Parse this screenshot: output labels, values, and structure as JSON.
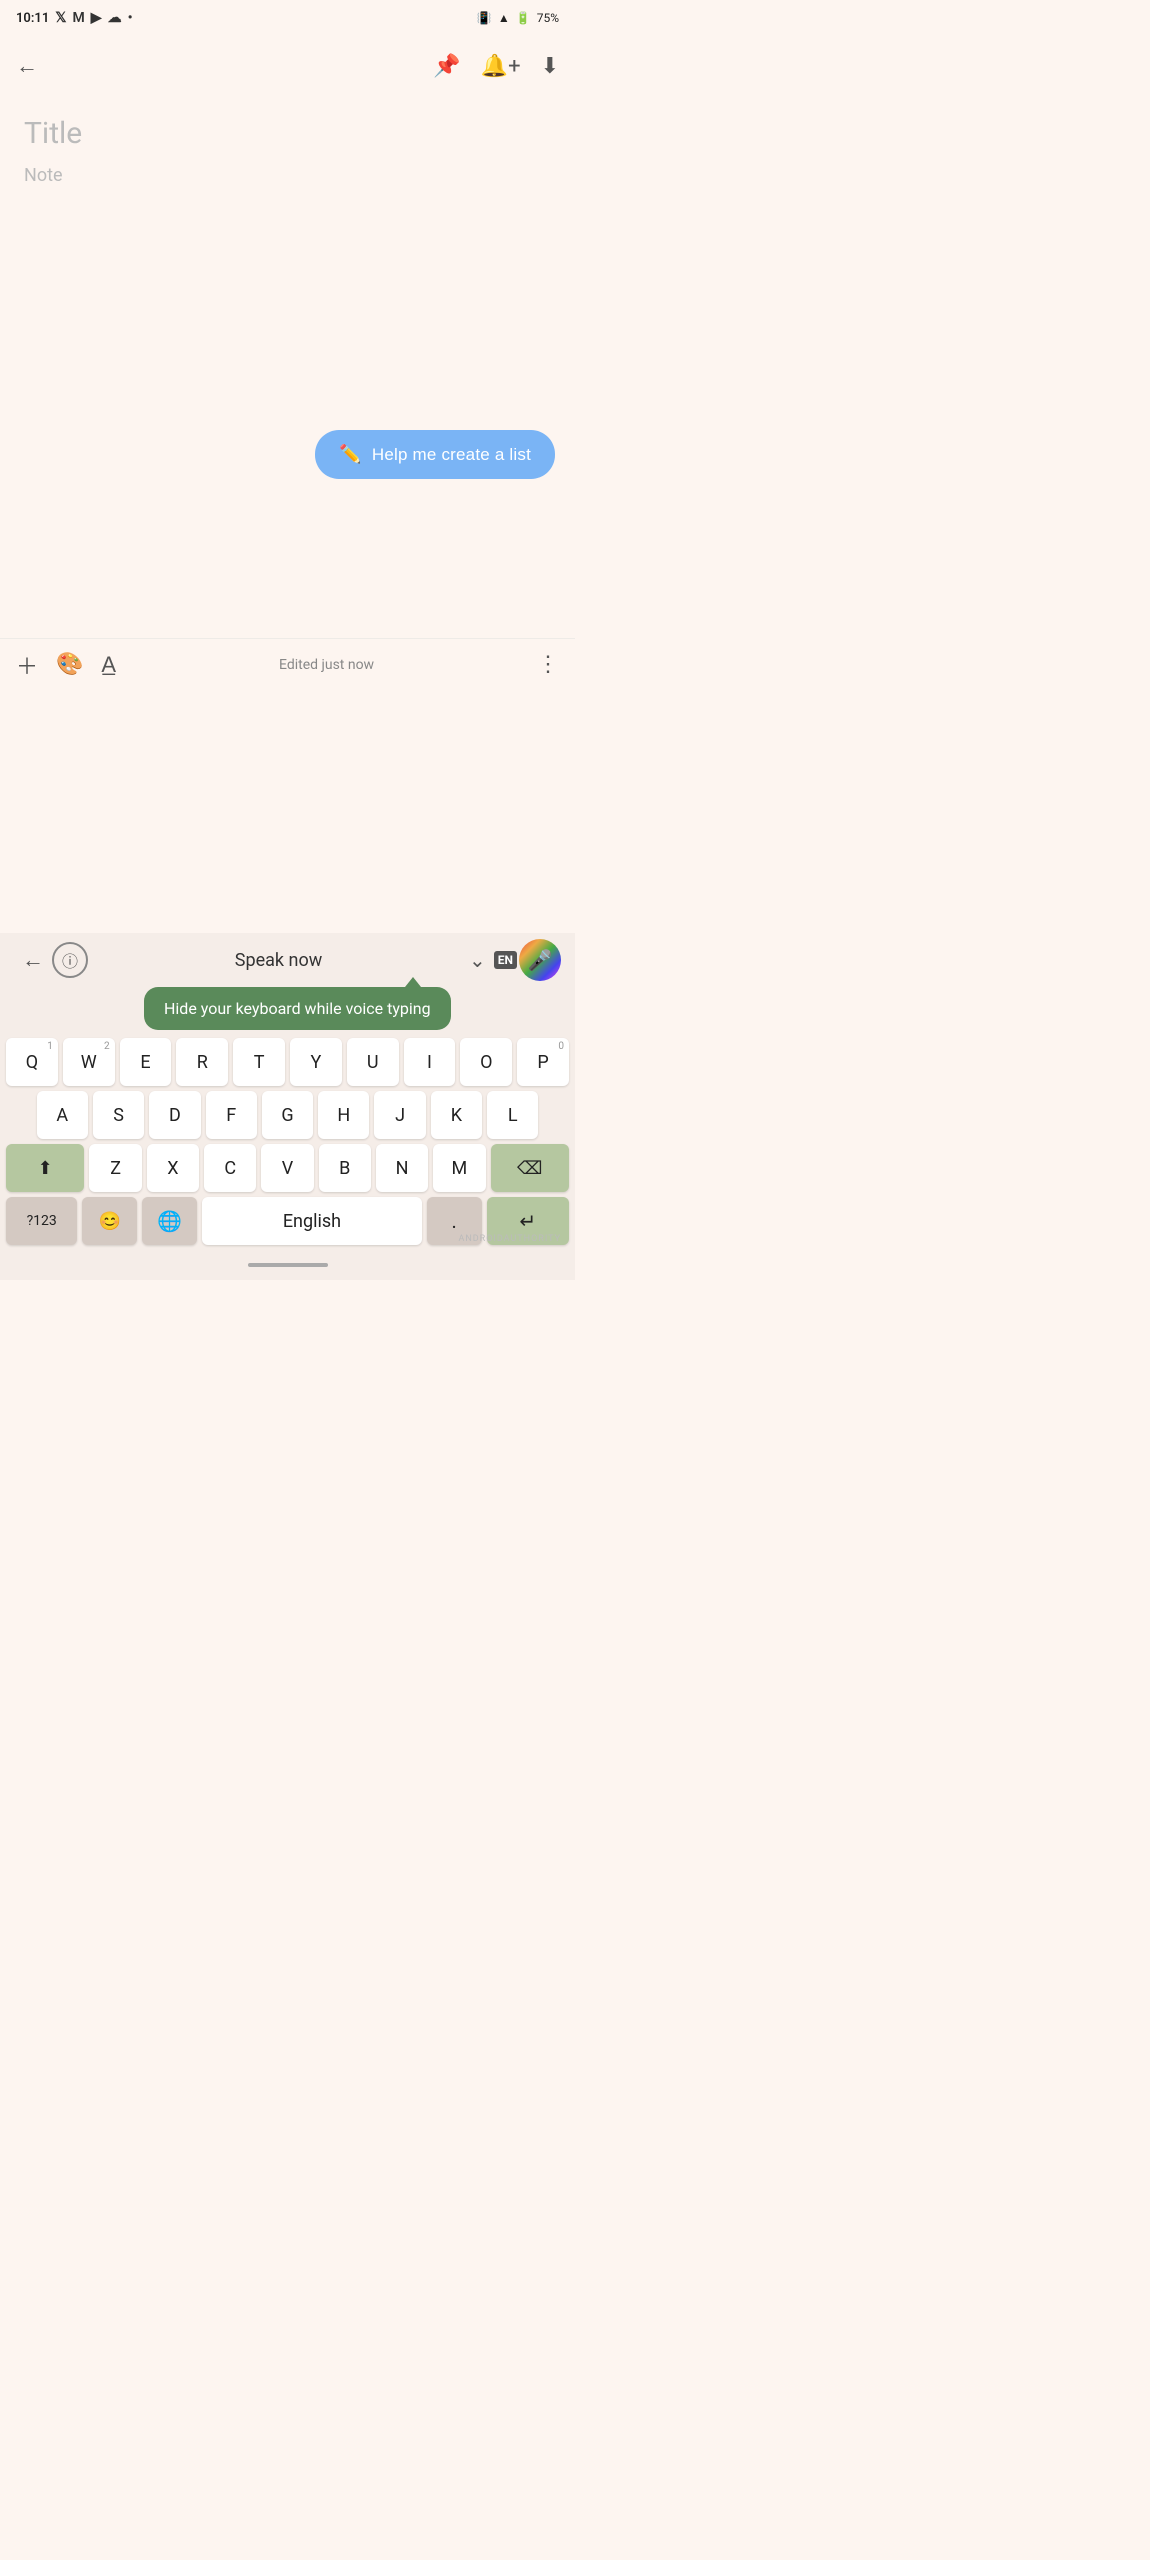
{
  "status_bar": {
    "time": "10:11",
    "battery": "75%",
    "icons": [
      "twitter",
      "gmail",
      "telegram",
      "cloud",
      "dot"
    ]
  },
  "toolbar": {
    "back_label": "←",
    "pin_icon": "📌",
    "reminder_icon": "🔔",
    "archive_icon": "⬇"
  },
  "note": {
    "title_placeholder": "Title",
    "body_placeholder": "Note"
  },
  "ai_button": {
    "label": "Help me create a list",
    "icon": "✏️"
  },
  "note_toolbar": {
    "add_icon": "＋",
    "palette_icon": "🎨",
    "format_icon": "A",
    "edited_text": "Edited just now",
    "more_icon": "⋮"
  },
  "voice_bar": {
    "back_label": "←",
    "info_label": "ℹ",
    "speak_now": "Speak now",
    "chevron": "⌄",
    "en_badge": "EN",
    "mic_icon": "🎤"
  },
  "tooltip": {
    "text": "Hide your keyboard while voice typing"
  },
  "keyboard": {
    "row1": [
      {
        "key": "Q",
        "num": "1"
      },
      {
        "key": "W",
        "num": "2"
      },
      {
        "key": "E",
        "num": ""
      },
      {
        "key": "R",
        "num": ""
      },
      {
        "key": "T",
        "num": ""
      },
      {
        "key": "Y",
        "num": ""
      },
      {
        "key": "U",
        "num": ""
      },
      {
        "key": "I",
        "num": ""
      },
      {
        "key": "O",
        "num": ""
      },
      {
        "key": "P",
        "num": "0"
      }
    ],
    "row2": [
      {
        "key": "A"
      },
      {
        "key": "S"
      },
      {
        "key": "D"
      },
      {
        "key": "F"
      },
      {
        "key": "G"
      },
      {
        "key": "H"
      },
      {
        "key": "J"
      },
      {
        "key": "K"
      },
      {
        "key": "L"
      }
    ],
    "row3": [
      {
        "key": "⬆",
        "type": "shift"
      },
      {
        "key": "Z"
      },
      {
        "key": "X"
      },
      {
        "key": "C"
      },
      {
        "key": "V"
      },
      {
        "key": "B"
      },
      {
        "key": "N"
      },
      {
        "key": "M"
      },
      {
        "key": "⌫",
        "type": "backspace"
      }
    ],
    "row4": [
      {
        "key": "?123",
        "type": "num-sym"
      },
      {
        "key": "😊",
        "type": "emoji"
      },
      {
        "key": "🌐",
        "type": "globe"
      },
      {
        "key": "English",
        "type": "space"
      },
      {
        "key": ".",
        "type": "period"
      },
      {
        "key": "↵",
        "type": "enter"
      }
    ]
  },
  "watermark": "ANDROIDAUTHORITY"
}
